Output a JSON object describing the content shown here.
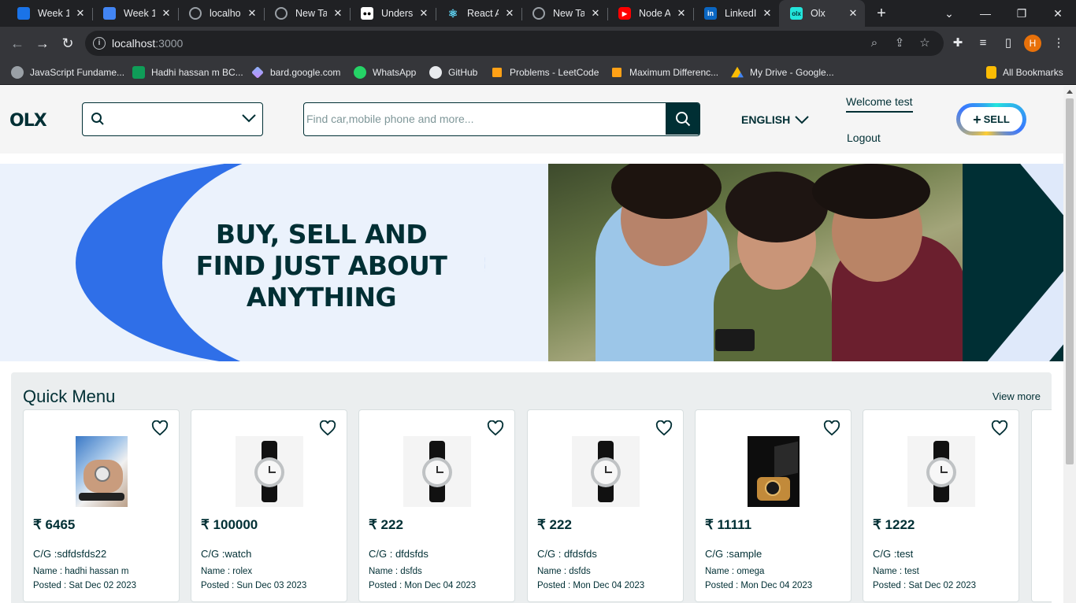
{
  "browser": {
    "tabs": [
      {
        "title": "Week 1",
        "color": "#1a73e8"
      },
      {
        "title": "Week 1",
        "color": "#4285f4"
      },
      {
        "title": "localho",
        "color": "#5f6368"
      },
      {
        "title": "New Tal",
        "color": "#5f6368"
      },
      {
        "title": "Underst",
        "color": "#000000"
      },
      {
        "title": "React A",
        "color": "#35363a"
      },
      {
        "title": "New Tal",
        "color": "#5f6368"
      },
      {
        "title": "Node A",
        "color": "#ff0000"
      },
      {
        "title": "LinkedI",
        "color": "#0a66c2"
      },
      {
        "title": "Olx",
        "color": "#23e5db"
      }
    ],
    "url_host": "localhost",
    "url_port": ":3000",
    "profile_initial": "H",
    "bookmarks": [
      {
        "label": "JavaScript Fundame...",
        "color": "#9aa0a6"
      },
      {
        "label": "Hadhi hassan m BC...",
        "color": "#0f9d58"
      },
      {
        "label": "bard.google.com",
        "color": "#8ab4f8"
      },
      {
        "label": "WhatsApp",
        "color": "#25d366"
      },
      {
        "label": "GitHub",
        "color": "#e8eaed"
      },
      {
        "label": "Problems - LeetCode",
        "color": "#ffa116"
      },
      {
        "label": "Maximum Differenc...",
        "color": "#ffa116"
      },
      {
        "label": "My Drive - Google...",
        "color": "#fbbc04"
      }
    ],
    "all_bookmarks": "All Bookmarks"
  },
  "header": {
    "logo": "OLX",
    "search_placeholder": "Find car,mobile phone and more...",
    "language": "ENGLISH",
    "welcome": "Welcome test",
    "logout": "Logout",
    "sell": "SELL"
  },
  "banner": {
    "headline_line1": "BUY, SELL AND",
    "headline_line2": "FIND JUST ABOUT",
    "headline_line3": "ANYTHING"
  },
  "quick_menu": {
    "title": "Quick Menu",
    "view_more": "View more",
    "cards": [
      {
        "price": "₹ 6465",
        "category": "C/G :sdfdsfds22",
        "name": "Name : hadhi hassan m",
        "posted": "Posted : Sat Dec 02 2023",
        "image": "wrist-watch"
      },
      {
        "price": "₹ 100000",
        "category": "C/G :watch",
        "name": "Name : rolex",
        "posted": "Posted : Sun Dec 03 2023",
        "image": "silver-watch"
      },
      {
        "price": "₹ 222",
        "category": "C/G : dfdsfds",
        "name": "Name : dsfds",
        "posted": "Posted : Mon Dec 04 2023",
        "image": "silver-watch"
      },
      {
        "price": "₹ 222",
        "category": "C/G : dfdsfds",
        "name": "Name : dsfds",
        "posted": "Posted : Mon Dec 04 2023",
        "image": "silver-watch"
      },
      {
        "price": "₹ 11111",
        "category": "C/G :sample",
        "name": "Name : omega",
        "posted": "Posted : Mon Dec 04 2023",
        "image": "boxed-watch"
      },
      {
        "price": "₹ 1222",
        "category": "C/G :test",
        "name": "Name : test",
        "posted": "Posted : Sat Dec 02 2023",
        "image": "silver-watch"
      }
    ]
  },
  "colors": {
    "olx_dark": "#002f34",
    "banner_blue": "#2f6fe8",
    "banner_bg": "#ebf2fc"
  }
}
